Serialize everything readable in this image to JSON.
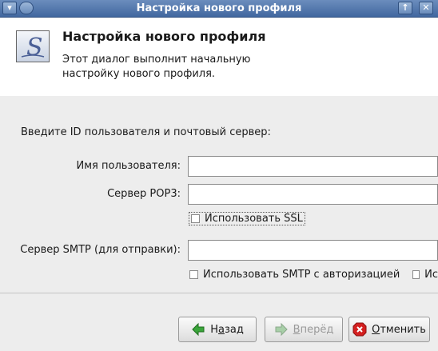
{
  "window": {
    "title": "Настройка нового профиля",
    "menu_glyph": "▾",
    "keep_above_glyph": "↑",
    "close_glyph": "✕"
  },
  "header": {
    "heading": "Настройка нового профиля",
    "description": "Этот диалог выполнит начальную настройку нового профиля.",
    "logo_letter": "S",
    "logo_icon": "profile-logo-icon"
  },
  "form": {
    "prompt": "Введите ID пользователя и почтовый сервер:",
    "username_label": "Имя пользователя:",
    "username_value": "",
    "pop3_label": "Сервер POP3:",
    "pop3_value": "",
    "ssl_label": "Использовать SSL",
    "ssl_checked": false,
    "smtp_label": "Сервер SMTP (для отправки):",
    "smtp_value": "",
    "smtp_auth_label": "Использовать SMTP с авторизацией",
    "smtp_auth_checked": false,
    "extra_checkbox_label": "Ис",
    "extra_checkbox_checked": false
  },
  "buttons": {
    "back_prefix": "Н",
    "back_mnemonic": "а",
    "back_suffix": "зад",
    "forward_mnemonic": "В",
    "forward_suffix": "перёд",
    "cancel_mnemonic": "О",
    "cancel_suffix": "тменить",
    "forward_enabled": false
  },
  "colors": {
    "titlebar": "#4a70a8",
    "back_arrow": "#3aa53a",
    "cancel_icon": "#d42020"
  }
}
